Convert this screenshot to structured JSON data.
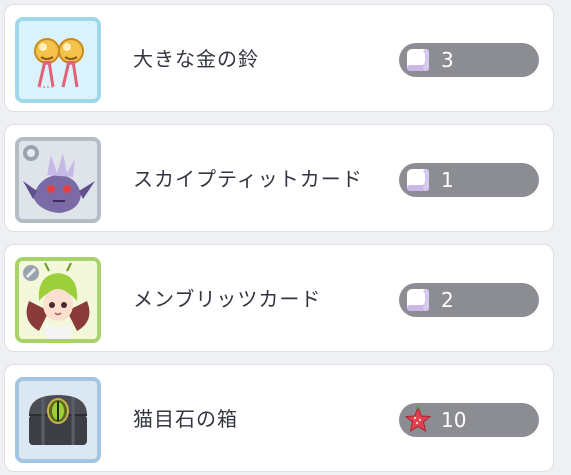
{
  "items": [
    {
      "name": "大きな金の鈴",
      "count": "3",
      "thumb_icon": "golden-bells-icon",
      "currency_icon": "white-cube-icon"
    },
    {
      "name": "スカイプティットカード",
      "count": "1",
      "thumb_icon": "purple-dragon-card-icon",
      "currency_icon": "white-cube-icon"
    },
    {
      "name": "メンブリッツカード",
      "count": "2",
      "thumb_icon": "fairy-girl-card-icon",
      "currency_icon": "white-cube-icon"
    },
    {
      "name": "猫目石の箱",
      "count": "10",
      "thumb_icon": "cats-eye-chest-icon",
      "currency_icon": "red-star-icon"
    }
  ],
  "colors": {
    "background": "#eef0f3",
    "pill": "#8b8d92",
    "text": "#333640"
  }
}
